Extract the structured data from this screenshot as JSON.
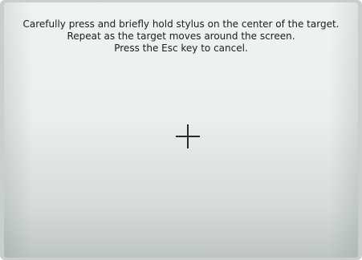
{
  "calibration": {
    "instructions": [
      "Carefully press and briefly hold stylus on the center of the target.",
      "Repeat as the target moves around the screen.",
      "Press the Esc key to cancel."
    ],
    "target_icon": "crosshair-icon"
  }
}
